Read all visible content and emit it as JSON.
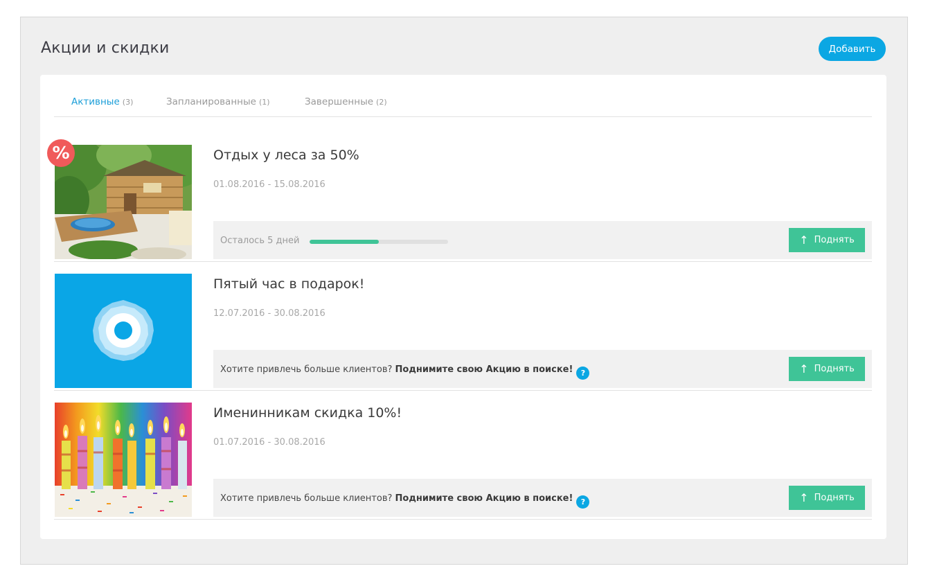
{
  "page": {
    "title": "Акции и скидки",
    "add_label": "Добавить"
  },
  "tabs": [
    {
      "label": "Активные",
      "count": "(3)",
      "active": true
    },
    {
      "label": "Запланированные",
      "count": "(1)",
      "active": false
    },
    {
      "label": "Завершенные",
      "count": "(2)",
      "active": false
    }
  ],
  "promotions": [
    {
      "title": "Отдых у леса за 50%",
      "dates": "01.08.2016 - 15.08.2016",
      "badge": "%",
      "remaining_label": "Осталось 5 дней",
      "progress_fraction": 0.5,
      "raise_label": "Поднять"
    },
    {
      "title": "Пятый час в подарок!",
      "dates": "12.07.2016 - 30.08.2016",
      "cta_text": "Хотите привлечь больше клиентов?",
      "cta_bold": "Поднимите свою Акцию в поиске!",
      "help_label": "?",
      "raise_label": "Поднять"
    },
    {
      "title": "Именинникам скидка 10%!",
      "dates": "01.07.2016 - 30.08.2016",
      "cta_text": "Хотите привлечь больше клиентов?",
      "cta_bold": "Поднимите свою Акцию в поиске!",
      "help_label": "?",
      "raise_label": "Поднять"
    }
  ],
  "colors": {
    "accent_blue": "#0ba7e3",
    "accent_green": "#3fc497",
    "badge_red": "#f05a5a"
  }
}
